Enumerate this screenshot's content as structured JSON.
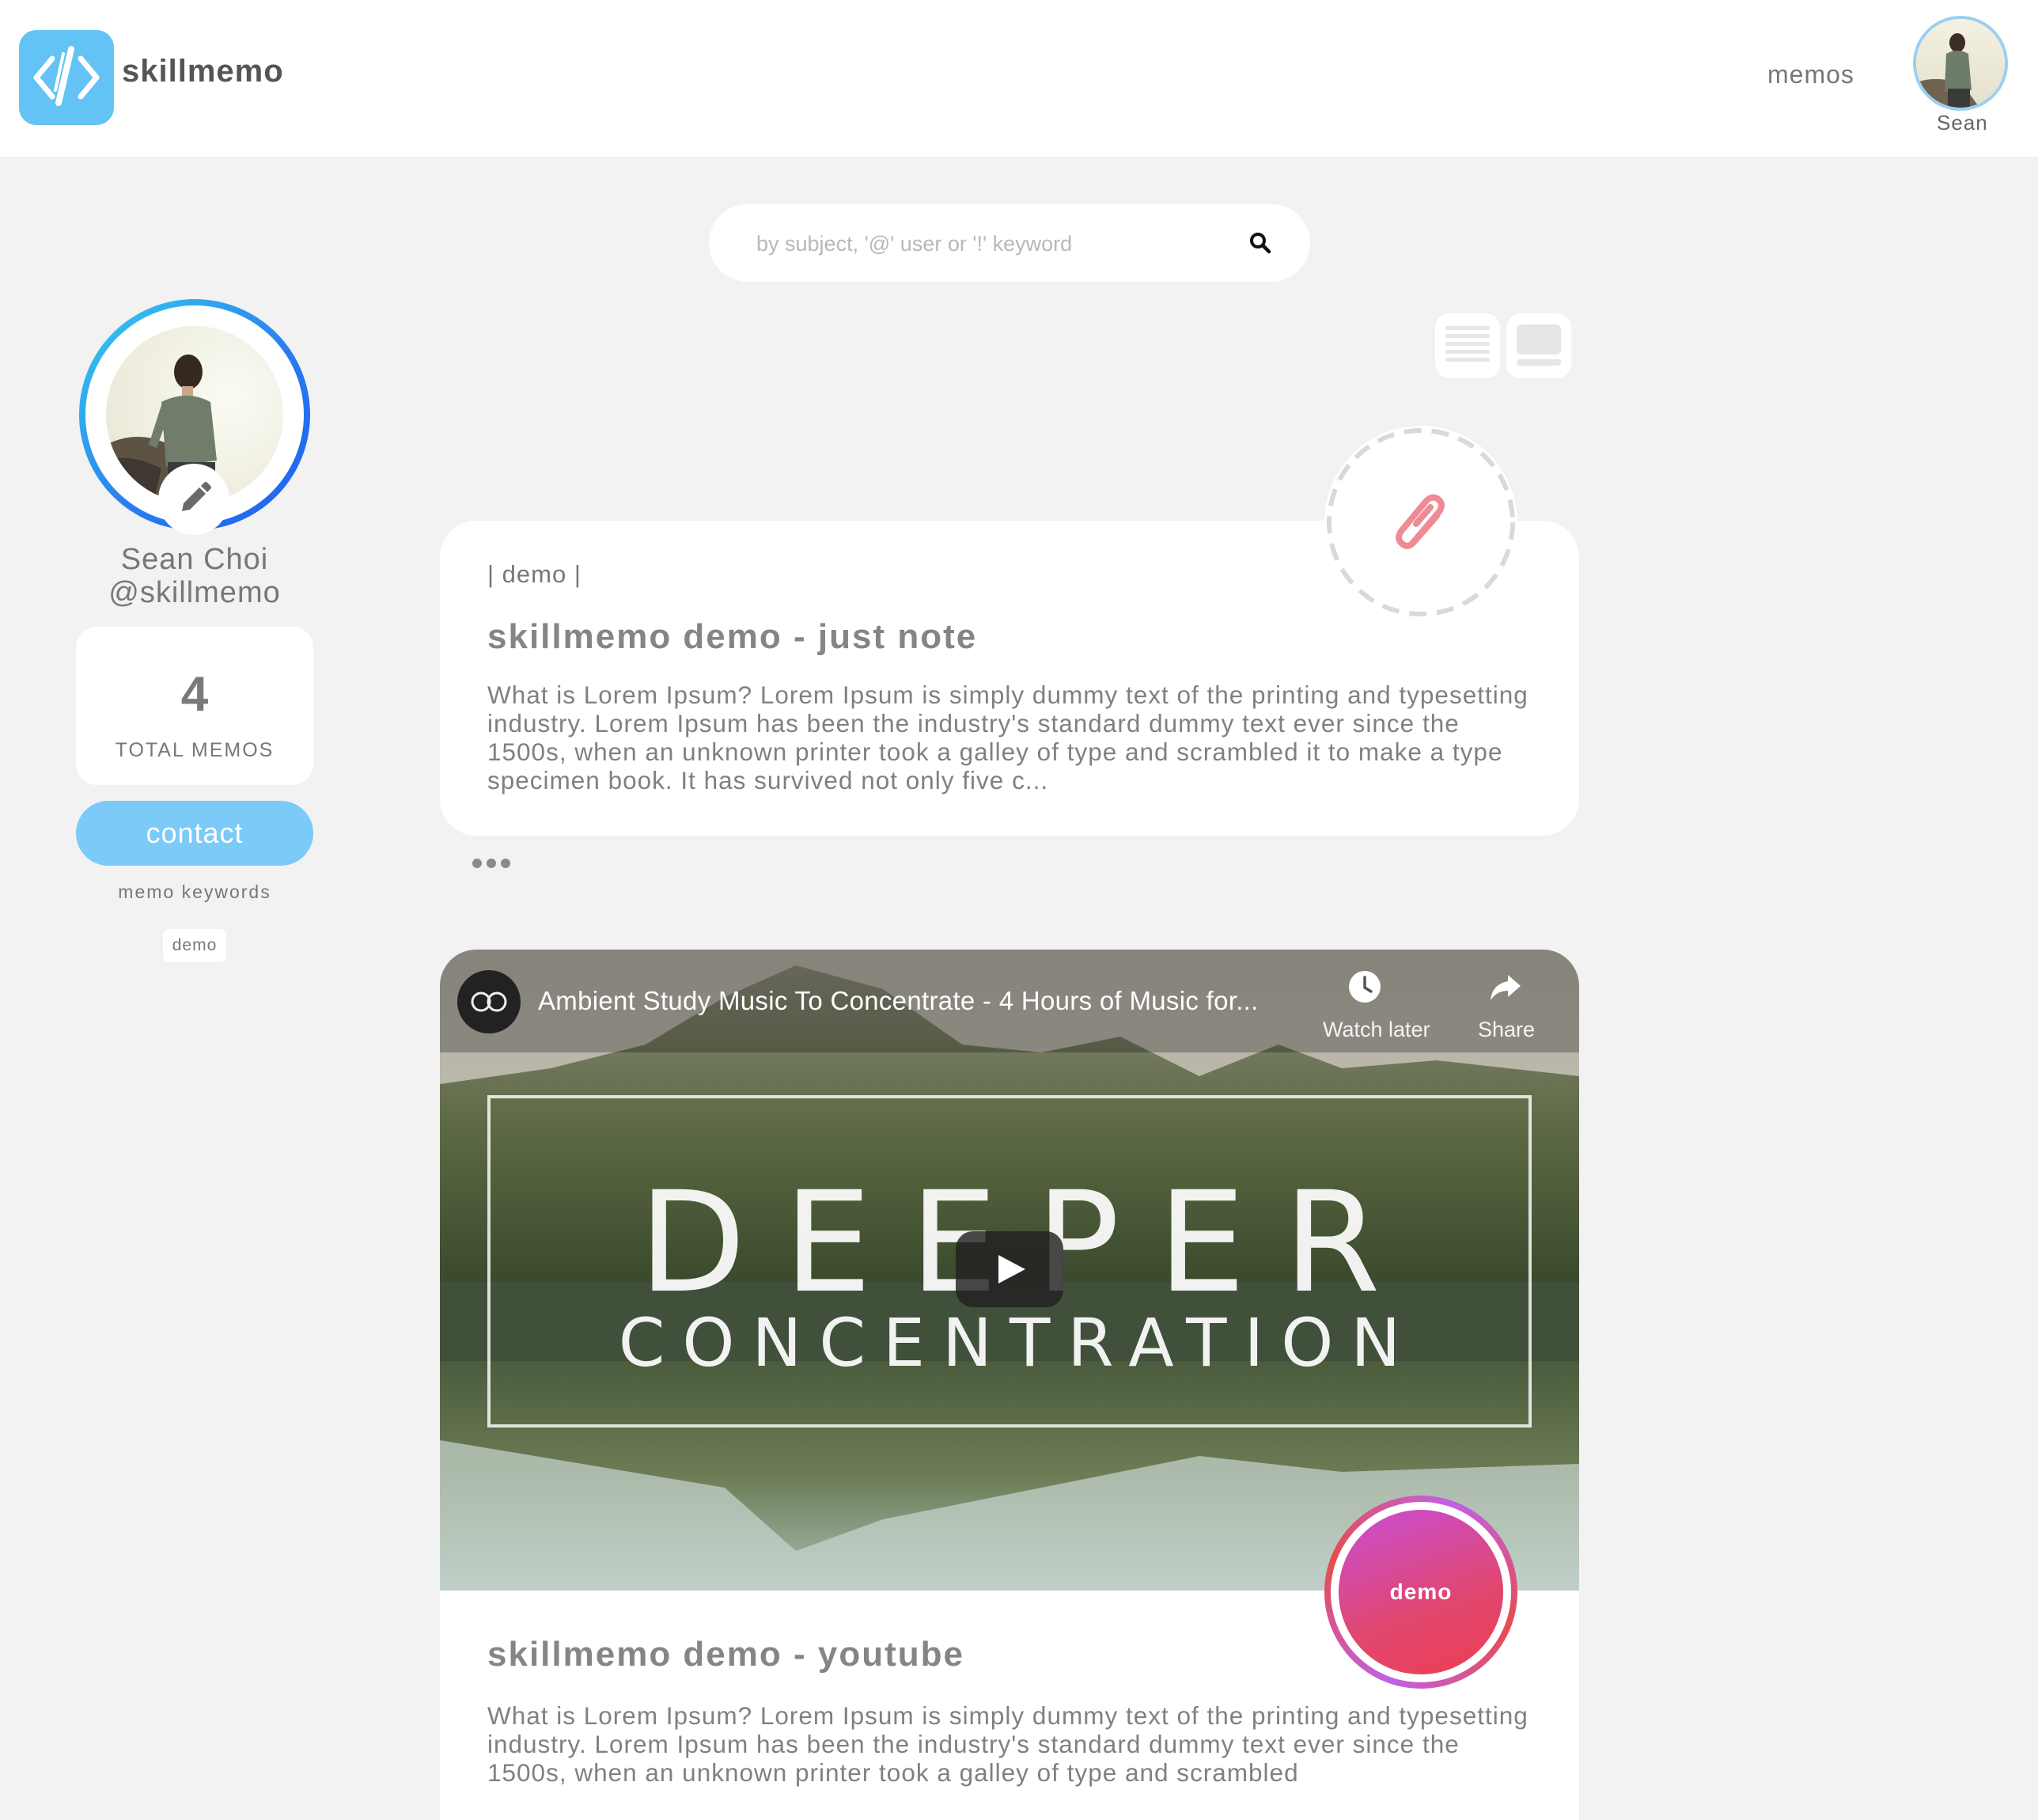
{
  "header": {
    "brand": "skillmemo",
    "nav_memos": "memos",
    "username": "Sean"
  },
  "search": {
    "placeholder": "by subject, '@' user or '!' keyword",
    "value": ""
  },
  "view_toggles": {
    "icons": [
      "list-view-icon",
      "card-view-icon"
    ]
  },
  "profile": {
    "name": "Sean Choi",
    "handle": "@skillmemo",
    "total_memos": "4",
    "total_memos_label": "TOTAL MEMOS",
    "contact_label": "contact",
    "keywords_title": "memo keywords",
    "keywords": [
      "demo"
    ]
  },
  "memos": [
    {
      "tag": "| demo |",
      "title": "skillmemo demo - just note",
      "body": "What is Lorem Ipsum? Lorem Ipsum is simply dummy text of the printing and typesetting industry. Lorem Ipsum has been the industry's standard dummy text ever since the 1500s, when an unknown printer took a galley of type and scrambled it to make a type specimen book. It has survived not only five c...",
      "badge_icon": "paperclip-icon"
    },
    {
      "title": "skillmemo demo - youtube",
      "body": "What is Lorem Ipsum? Lorem Ipsum is simply dummy text of the printing and typesetting industry. Lorem Ipsum has been the industry's standard dummy text ever since the 1500s, when an unknown printer took a galley of type and scrambled",
      "badge_label": "demo",
      "video": {
        "title": "Ambient Study Music To Concentrate - 4 Hours of Music for...",
        "watch_later": "Watch later",
        "share": "Share",
        "headline_1": "DEEPER",
        "headline_2": "CONCENTRATION"
      }
    }
  ],
  "colors": {
    "accent_blue": "#63c3f5",
    "contact_blue": "#7ccaf8",
    "page_bg": "#f2f2f2",
    "attach_pink": "#f08a95",
    "badge_pink": "#e0466e",
    "badge_purple": "#c84fd6"
  }
}
